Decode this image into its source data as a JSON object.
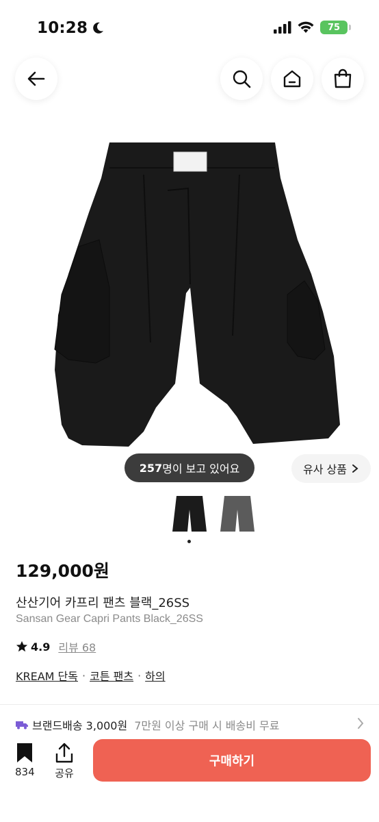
{
  "status_bar": {
    "time": "10:28",
    "battery": "75"
  },
  "header": {
    "back_icon": "arrow-left-icon",
    "search_icon": "search-icon",
    "home_icon": "home-icon",
    "bag_icon": "shopping-bag-icon"
  },
  "product": {
    "viewers_count": "257",
    "viewers_text": "명이 보고 있어요",
    "similar_label": "유사 상품",
    "price": "129,000원",
    "name_ko": "산산기어 카프리 팬츠 블랙_26SS",
    "name_en": "Sansan Gear Capri Pants Black_26SS",
    "rating": "4.9",
    "review_label": "리뷰 68",
    "tags": [
      "KREAM 단독",
      "코튼 팬츠",
      "하의"
    ],
    "thumbnail_colors": [
      "#1b1b1b",
      "#5b5b5b"
    ]
  },
  "shipping": {
    "label": "브랜드배송 3,000원",
    "note": "7만원 이상 구매 시 배송비 무료"
  },
  "bottom_bar": {
    "bookmark_count": "834",
    "share_label": "공유",
    "buy_label": "구매하기"
  },
  "colors": {
    "accent": "#ef6253",
    "battery": "#59c45f",
    "shipping_icon": "#7b5cd6"
  }
}
